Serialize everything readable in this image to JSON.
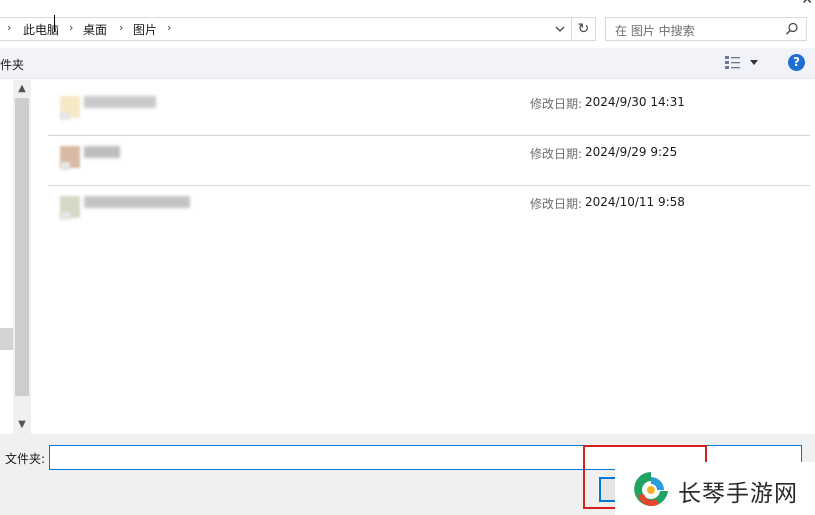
{
  "window": {
    "close_glyph": "✕"
  },
  "address_bar": {
    "lead_chevron": "›",
    "crumbs": [
      "此电脑",
      "桌面",
      "图片"
    ],
    "separator": "›",
    "dropdown_icon": "chevron-down-icon",
    "refresh_icon": "↻"
  },
  "search": {
    "placeholder": "在 图片 中搜索",
    "icon": "search-icon"
  },
  "toolbar": {
    "new_folder_label": "件夹",
    "view_icon": "details-view-icon",
    "help_label": "?"
  },
  "nav_scroll": {
    "up": "▲",
    "down": "▼"
  },
  "files": [
    {
      "modified_label": "修改日期:",
      "modified": "2024/9/30 14:31"
    },
    {
      "modified_label": "修改日期:",
      "modified": "2024/9/29 9:25"
    },
    {
      "modified_label": "修改日期:",
      "modified": "2024/10/11 9:58"
    }
  ],
  "folder_field": {
    "label": "文件夹:",
    "value": ""
  },
  "watermark": {
    "text": "长琴手游网"
  },
  "colors": {
    "accent": "#0078d7",
    "highlight_box": "#d61f1f",
    "toolbar_bg": "#f1f3f8",
    "help": "#1e6fd1"
  }
}
